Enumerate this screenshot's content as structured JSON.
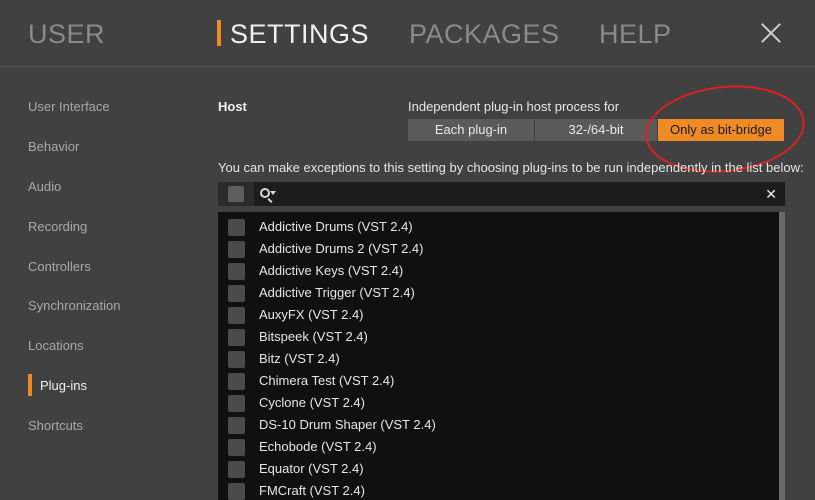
{
  "nav": {
    "tabs": [
      {
        "label": "USER"
      },
      {
        "label": "SETTINGS"
      },
      {
        "label": "PACKAGES"
      },
      {
        "label": "HELP"
      }
    ],
    "active_tab": "SETTINGS"
  },
  "sidebar": {
    "items": [
      {
        "label": "User Interface"
      },
      {
        "label": "Behavior"
      },
      {
        "label": "Audio"
      },
      {
        "label": "Recording"
      },
      {
        "label": "Controllers"
      },
      {
        "label": "Synchronization"
      },
      {
        "label": "Locations"
      },
      {
        "label": "Plug-ins"
      },
      {
        "label": "Shortcuts"
      }
    ],
    "active_item": "Plug-ins"
  },
  "host": {
    "label": "Host",
    "process_label": "Independent plug-in host process for",
    "options": [
      {
        "label": "Each plug-in"
      },
      {
        "label": "32-/64-bit"
      },
      {
        "label": "Only as bit-bridge"
      }
    ],
    "selected_option": "Only as bit-bridge"
  },
  "exceptions_text": "You can make exceptions to this setting by choosing plug-ins to be run independently in the list below:",
  "filter": {
    "search_value": "",
    "clear_glyph": "✕"
  },
  "plugins": [
    {
      "name": "Addictive Drums (VST 2.4)",
      "checked": false
    },
    {
      "name": "Addictive Drums 2 (VST 2.4)",
      "checked": false
    },
    {
      "name": "Addictive Keys (VST 2.4)",
      "checked": false
    },
    {
      "name": "Addictive Trigger (VST 2.4)",
      "checked": false
    },
    {
      "name": "AuxyFX (VST 2.4)",
      "checked": false
    },
    {
      "name": "Bitspeek (VST 2.4)",
      "checked": false
    },
    {
      "name": "Bitz (VST 2.4)",
      "checked": false
    },
    {
      "name": "Chimera Test (VST 2.4)",
      "checked": false
    },
    {
      "name": "Cyclone (VST 2.4)",
      "checked": false
    },
    {
      "name": "DS-10 Drum Shaper (VST 2.4)",
      "checked": false
    },
    {
      "name": "Echobode (VST 2.4)",
      "checked": false
    },
    {
      "name": "Equator (VST 2.4)",
      "checked": false
    },
    {
      "name": "FMCraft (VST 2.4)",
      "checked": false
    }
  ],
  "colors": {
    "background": "#414141",
    "accent": "#f08a24",
    "annotation": "#e02020",
    "list_background": "#101010"
  },
  "icons": {
    "close": "close-icon",
    "search": "search-icon",
    "dropdown": "chevron-down-icon"
  }
}
